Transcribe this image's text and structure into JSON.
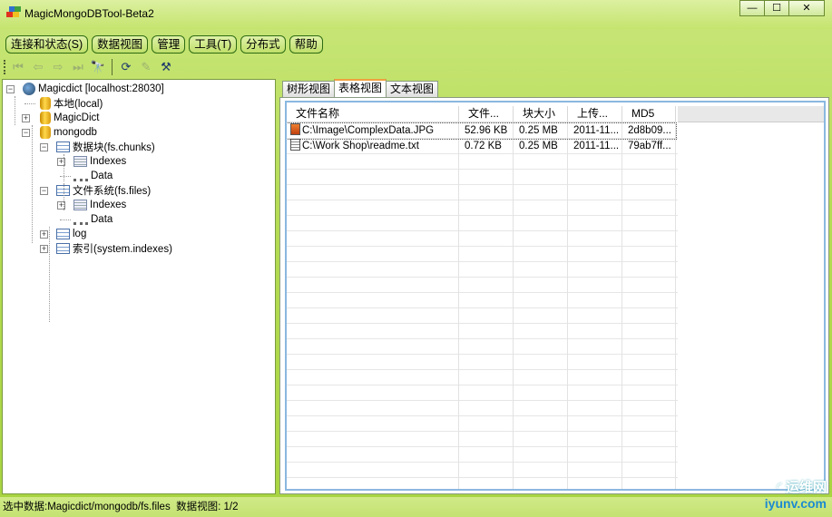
{
  "window": {
    "title": "MagicMongoDBTool-Beta2",
    "controls": [
      "—",
      "☐",
      "✕"
    ]
  },
  "menu": [
    {
      "label": "连接和状态(S)"
    },
    {
      "label": "数据视图"
    },
    {
      "label": "管理"
    },
    {
      "label": "工具(T)"
    },
    {
      "label": "分布式"
    },
    {
      "label": "帮助"
    }
  ],
  "toolbar": [
    {
      "icon": "first-icon",
      "g": "⏮",
      "enabled": false
    },
    {
      "icon": "prev-icon",
      "g": "⇦",
      "enabled": false
    },
    {
      "icon": "next-icon",
      "g": "⇨",
      "enabled": false
    },
    {
      "icon": "last-icon",
      "g": "⏭",
      "enabled": false
    },
    {
      "icon": "find-icon",
      "g": "🔭",
      "enabled": true
    },
    {
      "icon": "refresh-icon",
      "g": "⟳",
      "enabled": true
    },
    {
      "icon": "edit-icon",
      "g": "✎",
      "enabled": false
    },
    {
      "icon": "tools-icon",
      "g": "⚒",
      "enabled": true
    }
  ],
  "tree": [
    {
      "label": "Magicdict [localhost:28030]",
      "level": 0,
      "icon": "server",
      "exp": "-"
    },
    {
      "label": "本地(local)",
      "level": 1,
      "icon": "db",
      "exp": ""
    },
    {
      "label": "MagicDict",
      "level": 1,
      "icon": "db",
      "exp": "+"
    },
    {
      "label": "mongodb",
      "level": 1,
      "icon": "db",
      "exp": "-"
    },
    {
      "label": "数据块(fs.chunks)",
      "level": 2,
      "icon": "tbl",
      "exp": "-"
    },
    {
      "label": "Indexes",
      "level": 3,
      "icon": "idx",
      "exp": "+"
    },
    {
      "label": "Data",
      "level": 3,
      "icon": "tree",
      "exp": ""
    },
    {
      "label": "文件系统(fs.files)",
      "level": 2,
      "icon": "tbl",
      "exp": "-"
    },
    {
      "label": "Indexes",
      "level": 3,
      "icon": "idx",
      "exp": "+"
    },
    {
      "label": "Data",
      "level": 3,
      "icon": "tree",
      "exp": ""
    },
    {
      "label": "log",
      "level": 2,
      "icon": "tbl",
      "exp": "+"
    },
    {
      "label": "索引(system.indexes)",
      "level": 2,
      "icon": "tbl",
      "exp": "+"
    }
  ],
  "tabs": [
    {
      "label": "树形视图"
    },
    {
      "label": "表格视图",
      "active": true
    },
    {
      "label": "文本视图"
    }
  ],
  "table": {
    "columns": [
      "文件名称",
      "文件...",
      "块大小",
      "上传...",
      "MD5"
    ],
    "rows": [
      {
        "icon": "image-file-icon",
        "cells": [
          "C:\\Image\\ComplexData.JPG",
          "52.96 KB",
          "0.25 MB",
          "2011-11...",
          "2d8b09..."
        ]
      },
      {
        "icon": "text-file-icon",
        "cells": [
          "C:\\Work Shop\\readme.txt",
          "0.72 KB",
          "0.25 MB",
          "2011-11...",
          "79ab7ff..."
        ]
      }
    ]
  },
  "status": {
    "text": "选中数据:Magicdict/mongodb/fs.files  数据视图: 1/2"
  },
  "watermark": {
    "line1": "运维网",
    "line2": "iyunv.com"
  }
}
